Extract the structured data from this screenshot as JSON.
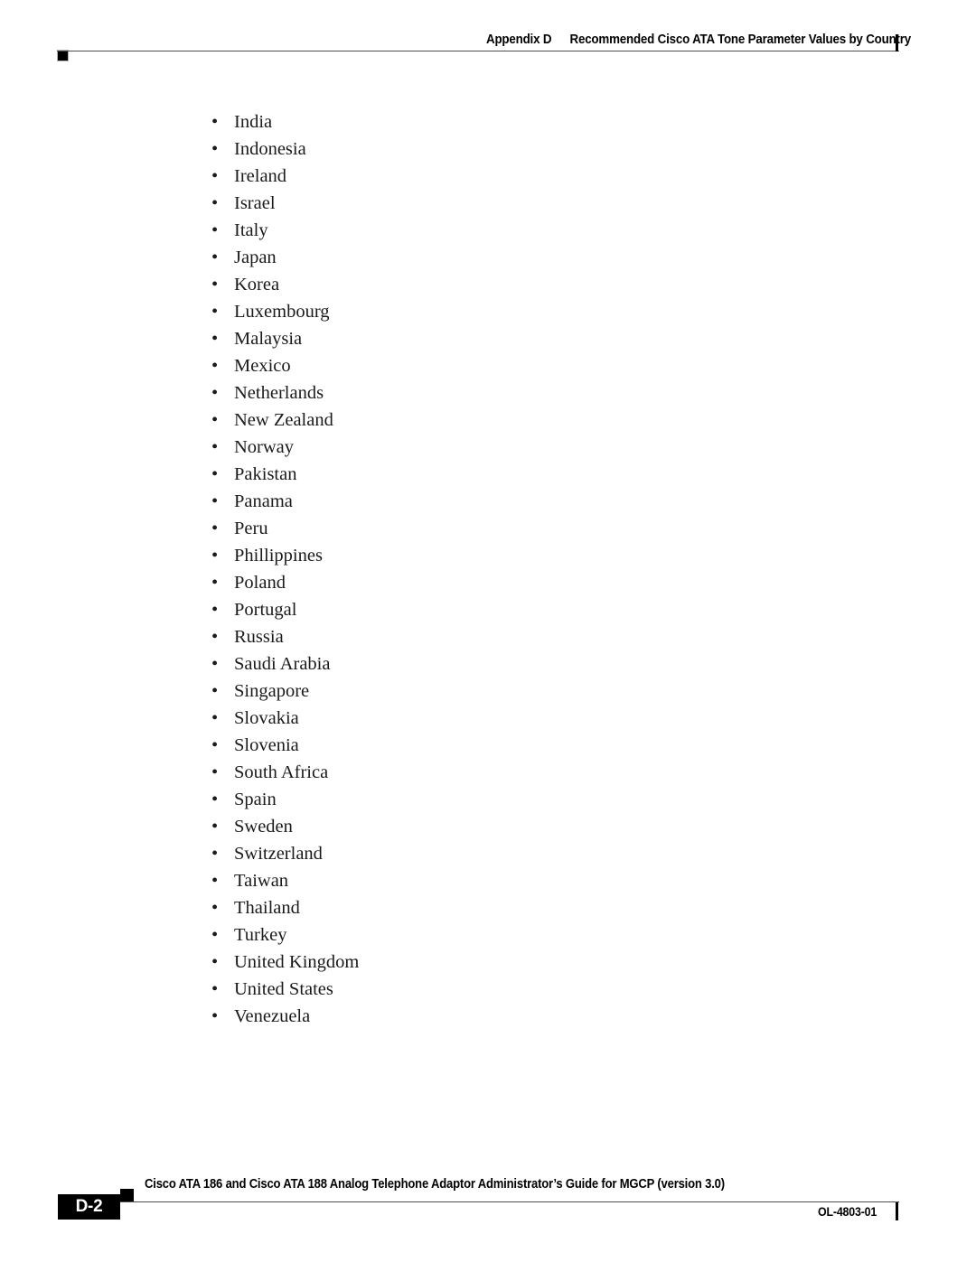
{
  "header": {
    "appendix_label": "Appendix D",
    "title": "Recommended Cisco ATA Tone Parameter Values by Country"
  },
  "main": {
    "countries": [
      "India",
      "Indonesia",
      "Ireland",
      "Israel",
      "Italy",
      "Japan",
      "Korea",
      "Luxembourg",
      "Malaysia",
      "Mexico",
      "Netherlands",
      "New Zealand",
      "Norway",
      "Pakistan",
      "Panama",
      "Peru",
      "Phillippines",
      "Poland",
      "Portugal",
      "Russia",
      "Saudi Arabia",
      "Singapore",
      "Slovakia",
      "Slovenia",
      "South Africa",
      "Spain",
      "Sweden",
      "Switzerland",
      "Taiwan",
      "Thailand",
      "Turkey",
      "United Kingdom",
      "United States",
      "Venezuela"
    ],
    "bullet_glyph": "•"
  },
  "footer": {
    "page_number": "D-2",
    "document_title": "Cisco ATA 186 and Cisco ATA 188 Analog Telephone Adaptor Administrator’s Guide for MGCP (version 3.0)",
    "document_id": "OL-4803-01"
  },
  "colors": {
    "text": "#1a1a1a",
    "rule": "#4d4d4d",
    "marker": "#000000",
    "page_bg": "#ffffff",
    "pagebox_text": "#ffffff"
  }
}
